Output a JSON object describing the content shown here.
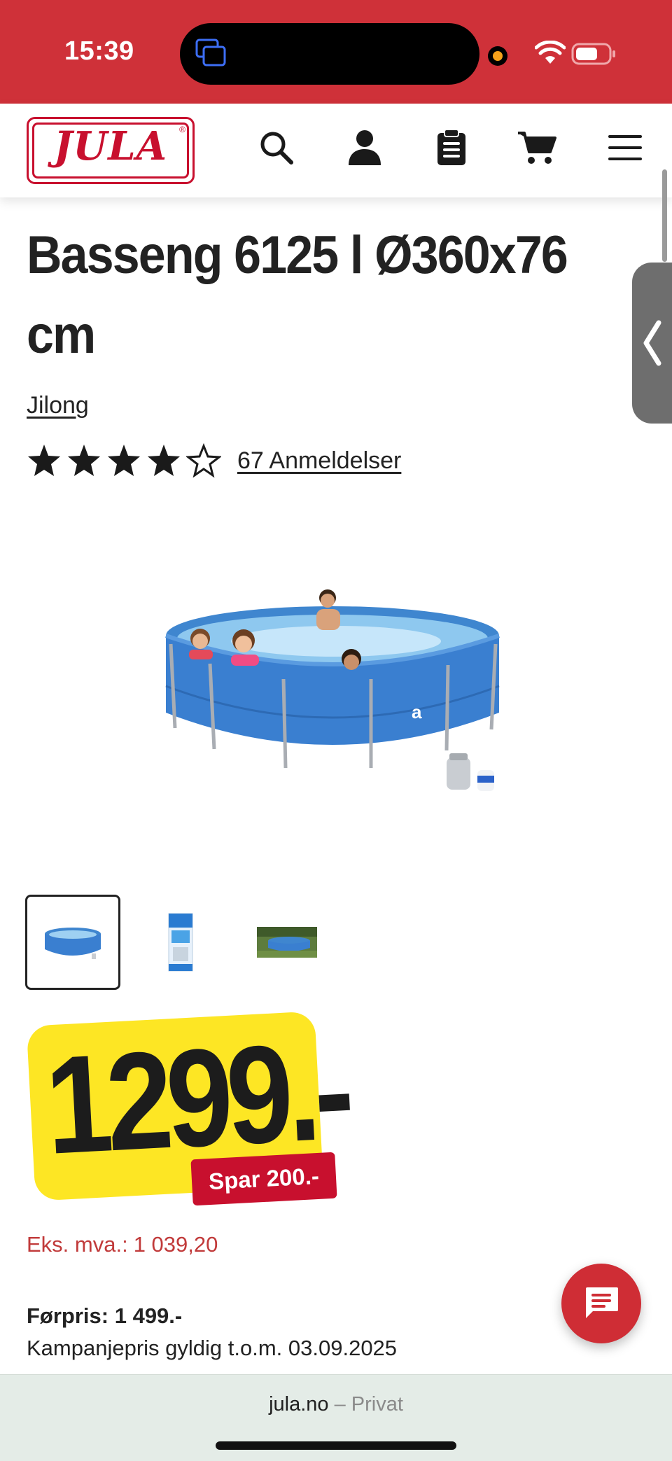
{
  "status_bar": {
    "time": "15:39",
    "background": "#cf3139"
  },
  "header": {
    "logo_text": "JULA",
    "logo_reg_mark": "®",
    "icons": [
      "search-icon",
      "account-icon",
      "shopping-list-icon",
      "cart-icon",
      "menu-icon"
    ],
    "brand_color": "#c8102e"
  },
  "product": {
    "title": "Basseng 6125 l Ø360x76 cm",
    "brand": "Jilong",
    "rating": 4,
    "rating_max": 5,
    "reviews_label": "67 Anmeldelser",
    "thumbnails": [
      "pool-photo",
      "package-photo",
      "garden-photo"
    ],
    "active_thumbnail": 0
  },
  "price": {
    "current": "1299.-",
    "save_label": "Spar 200.-",
    "ex_vat_label": "Eks. mva.:",
    "ex_vat_value": "1 039,20",
    "previous_price": "Førpris: 1 499.-",
    "campaign_text": "Kampanjepris gyldig t.o.m. 03.09.2025",
    "badge_color": "#fde624"
  },
  "chat": {
    "icon": "chat-icon"
  },
  "browser": {
    "domain": "jula.no",
    "separator": " – ",
    "mode": "Privat"
  }
}
